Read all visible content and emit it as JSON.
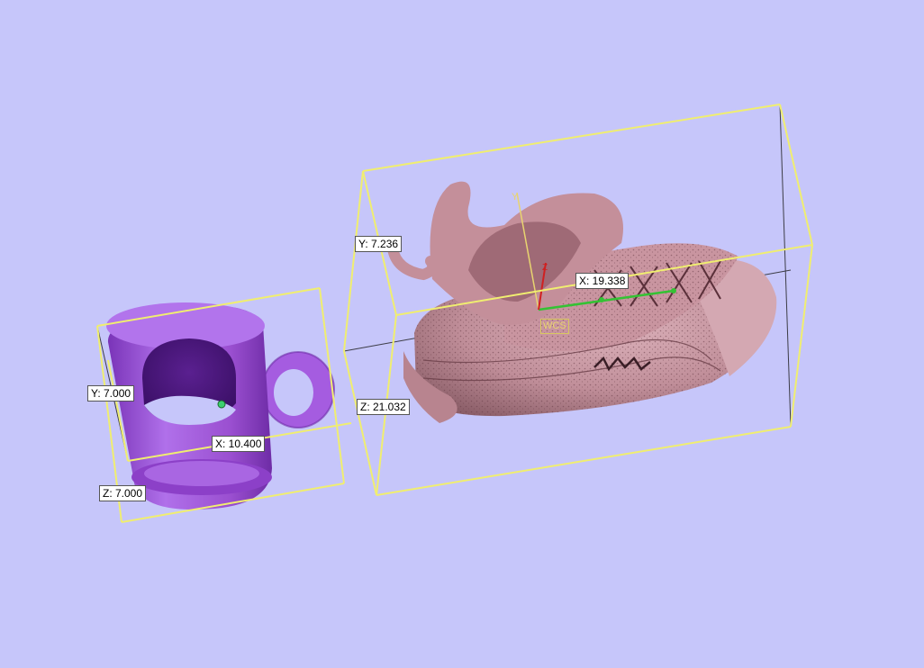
{
  "colors": {
    "background": "#c6c6fa",
    "bounding_box": "#f0ee70",
    "mug": "#9a4fd0",
    "shoe": "#c79aa4",
    "axis_x": "#34c234",
    "axis_y": "#e8d470",
    "axis_z": "#d02020"
  },
  "objects": [
    {
      "name": "mug",
      "dimensions": {
        "x": "X: 10.400",
        "y": "Y: 7.000",
        "z": "Z: 7.000"
      }
    },
    {
      "name": "shoe",
      "dimensions": {
        "x": "X: 19.338",
        "y": "Y: 7.236",
        "z": "Z: 21.032"
      }
    }
  ],
  "wcs": {
    "label": "WCS",
    "axis_y_letter": "Y",
    "axis_z_letter": "Z"
  }
}
